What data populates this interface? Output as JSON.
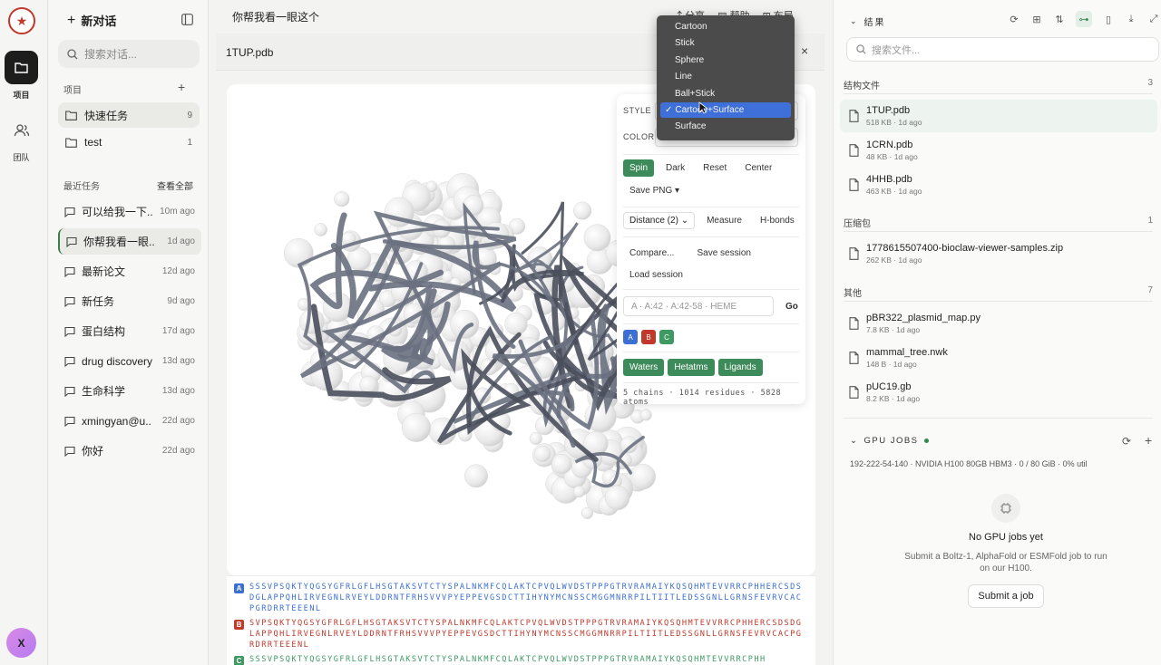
{
  "rail": {
    "logo_text": "★",
    "projects_label": "项目",
    "team_label": "团队",
    "avatar_letter": "X"
  },
  "sidebar": {
    "new_chat": "新对话",
    "search_placeholder": "搜索对话...",
    "projects_label": "项目",
    "projects": [
      {
        "name": "快速任务",
        "count": "9"
      },
      {
        "name": "test",
        "count": "1"
      }
    ],
    "recent_label": "最近任务",
    "view_all": "查看全部",
    "tasks": [
      {
        "title": "可以给我一下...",
        "ago": "10m ago"
      },
      {
        "title": "你帮我看一眼...",
        "ago": "1d ago"
      },
      {
        "title": "最新论文",
        "ago": "12d ago"
      },
      {
        "title": "新任务",
        "ago": "9d ago"
      },
      {
        "title": "蛋白结构",
        "ago": "17d ago"
      },
      {
        "title": "drug discovery",
        "ago": "13d ago"
      },
      {
        "title": "生命科学",
        "ago": "13d ago"
      },
      {
        "title": "xmingyan@u...",
        "ago": "22d ago"
      },
      {
        "title": "你好",
        "ago": "22d ago"
      }
    ]
  },
  "main": {
    "chat_title": "你帮我看一眼这个",
    "share": "分享",
    "help": "帮助",
    "layout": "布局",
    "file_name": "1TUP.pdb",
    "close": "×"
  },
  "panel": {
    "style_label": "STYLE",
    "color_label": "COLOR",
    "spin": "Spin",
    "dark": "Dark",
    "reset": "Reset",
    "center": "Center",
    "save_png": "Save PNG ▾",
    "distance": "Distance (2)",
    "measure": "Measure",
    "hbonds": "H-bonds",
    "compare": "Compare...",
    "save_session": "Save session",
    "load_session": "Load session",
    "select_placeholder": "A · A:42 · A:42-58 · HEME",
    "go": "Go",
    "chains": [
      "A",
      "B",
      "C"
    ],
    "waters": "Waters",
    "hetatms": "Hetatms",
    "ligands": "Ligands",
    "stats": "5 chains · 1014 residues · 5828 atoms"
  },
  "style_dropdown": {
    "options": [
      "Cartoon",
      "Stick",
      "Sphere",
      "Line",
      "Ball+Stick",
      "Cartoon+Surface",
      "Surface"
    ],
    "selected_mark": "✓",
    "selected": "Cartoon+Surface"
  },
  "sequences": [
    {
      "chain": "A",
      "color": "#3b6fd1",
      "text": "SSSVPSQKTYQGSYGFRLGFLHSGTAKSVTCTYSPALNKMFCQLAKTCPVQLWVDSTPPPGTRVRAMAIYKQSQHMTEVVRRCPHHERCSDSDGLAPPQHLIRVEGNLRVEYLDDRNTFRHSVVVPYEPPEVGSDCTTIHYNYMCNSSCMGGMNRRPILTIITLEDSSGNLLGRNSFEVRVCACPGRDRRTEEENL"
    },
    {
      "chain": "B",
      "color": "#c0392b",
      "text": "SVPSQKTYQGSYGFRLGFLHSGTAKSVTCTYSPALNKMFCQLAKTCPVQLWVDSTPPPGTRVRAMAIYKQSQHMTEVVRRCPHHERCSDSDGLAPPQHLIRVEGNLRVEYLDDRNTFRHSVVVPYEPPEVGSDCTTIHYNYMCNSSCMGGMNRRPILTIITLEDSSGNLLGRNSFEVRVCACPGRDRRTEEENL"
    },
    {
      "chain": "C",
      "color": "#3d9a63",
      "text": "SSSVPSQKTYQGSYGFRLGFLHSGTAKSVTCTYSPALNKMFCQLAKTCPVQLWVDSTPPPGTRVRAMAIYKQSQHMTEVVRRCPHH"
    }
  ],
  "right": {
    "header": "结果",
    "search_placeholder": "搜索文件...",
    "groups": [
      {
        "label": "结构文件",
        "count": "3",
        "files": [
          {
            "name": "1TUP.pdb",
            "meta": "518 KB · 1d ago"
          },
          {
            "name": "1CRN.pdb",
            "meta": "48 KB · 1d ago"
          },
          {
            "name": "4HHB.pdb",
            "meta": "463 KB · 1d ago"
          }
        ]
      },
      {
        "label": "压缩包",
        "count": "1",
        "files": [
          {
            "name": "1778615507400-bioclaw-viewer-samples.zip",
            "meta": "262 KB · 1d ago"
          }
        ]
      },
      {
        "label": "其他",
        "count": "7",
        "files": [
          {
            "name": "pBR322_plasmid_map.py",
            "meta": "7.8 KB · 1d ago"
          },
          {
            "name": "mammal_tree.nwk",
            "meta": "148 B · 1d ago"
          },
          {
            "name": "pUC19.gb",
            "meta": "8.2 KB · 1d ago"
          }
        ]
      }
    ],
    "gpu_title": "GPU JOBS",
    "gpu_status": "192-222-54-140 · NVIDIA H100 80GB HBM3 · 0 / 80 GiB · 0% util",
    "no_jobs": "No GPU jobs yet",
    "no_jobs_desc": "Submit a Boltz-1, AlphaFold or ESMFold job to run on our H100.",
    "submit": "Submit a job"
  },
  "colors": {
    "accent": "#3d8a5a",
    "selection": "#3f6fd8",
    "rail_active": "#1d1d1d"
  }
}
